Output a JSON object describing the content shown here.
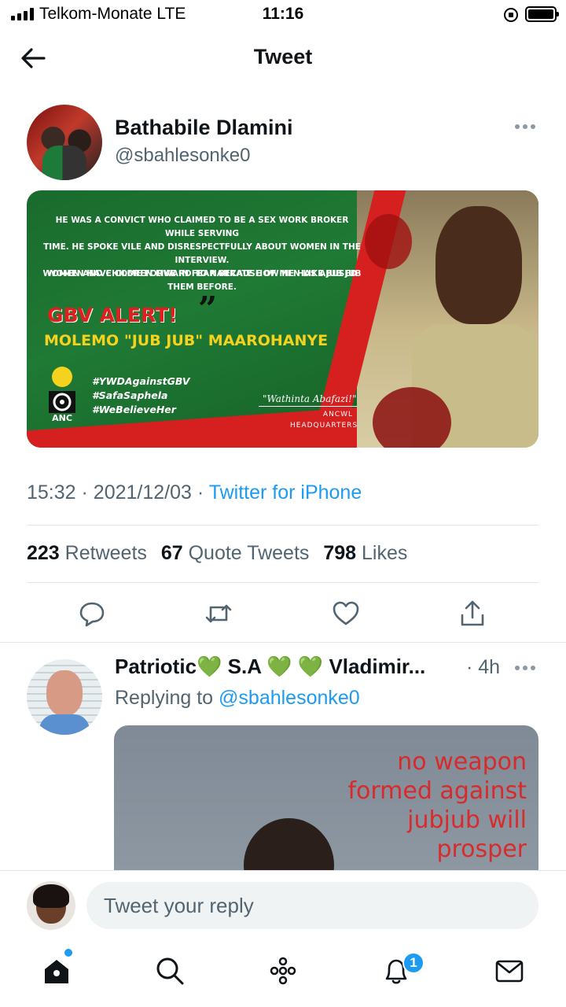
{
  "status_bar": {
    "carrier": "Telkom-Monate  LTE",
    "time": "11:16"
  },
  "nav": {
    "title": "Tweet"
  },
  "tweet": {
    "author_name": "Bathabile Dlamini",
    "author_handle": "@sbahlesonke0",
    "media": {
      "text_lines": [
        "He was a convict who claimed to be a sex work broker while serving",
        "time. He spoke vile and disrespectfully about women in the interview.",
        "Women have come forward to narrate how he has abused them before."
      ],
      "text_line_2": "Women and children live in fear because of men like Jub Jub",
      "alert": "GBV ALERT!",
      "subject": "MOLEMO \"JUB JUB\" MAAROHANYE",
      "hashtags": [
        "#YWDAgainstGBV",
        "#SafaSaphela",
        "#WeBelieveHer"
      ],
      "signature": "\"Wathinta Abafazi!\"",
      "org": "ANCWL",
      "org_sub": "HEADQUARTERS",
      "logo_text": "ANC"
    },
    "time": "15:32",
    "date": "2021/12/03",
    "source": "Twitter for iPhone",
    "stats": {
      "retweets_count": "223",
      "retweets_label": "Retweets",
      "quotes_count": "67",
      "quotes_label": "Quote Tweets",
      "likes_count": "798",
      "likes_label": "Likes"
    }
  },
  "reply": {
    "name_part1": "Patriotic",
    "name_part2": " S.A ",
    "name_part3": " Vladimir...",
    "heart": "💚",
    "time": "· 4h",
    "replying_prefix": "Replying to",
    "replying_to": "@sbahlesonke0",
    "media_overlay": "no weapon formed against jubjub will prosper"
  },
  "composer": {
    "placeholder": "Tweet your reply"
  },
  "tabbar": {
    "notifications_badge": "1"
  },
  "colors": {
    "accent": "#1d9bf0",
    "text_secondary": "#536471",
    "divider": "#e1e8ed"
  }
}
